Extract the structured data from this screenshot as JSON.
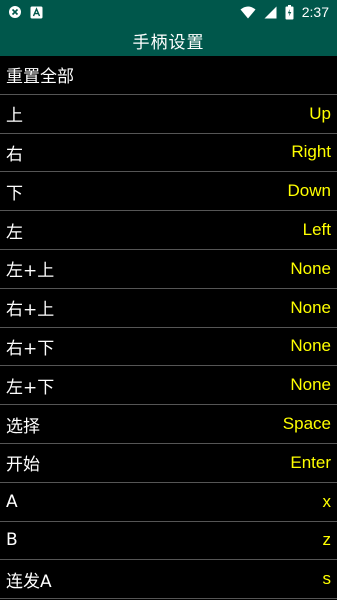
{
  "status_bar": {
    "time": "2:37",
    "left_icons": [
      "notification-close-icon",
      "text-a-icon"
    ],
    "right_icons": [
      "wifi-icon",
      "signal-icon",
      "battery-icon"
    ]
  },
  "app": {
    "title": "手柄设置",
    "accent_color": "#00574B",
    "value_color": "#FFFF00"
  },
  "rows": [
    {
      "label": "重置全部",
      "value": ""
    },
    {
      "label": "上",
      "value": "Up"
    },
    {
      "label": "右",
      "value": "Right"
    },
    {
      "label": "下",
      "value": "Down"
    },
    {
      "label": "左",
      "value": "Left"
    },
    {
      "label": "左+上",
      "value": "None"
    },
    {
      "label": "右+上",
      "value": "None"
    },
    {
      "label": "右+下",
      "value": "None"
    },
    {
      "label": "左+下",
      "value": "None"
    },
    {
      "label": "选择",
      "value": "Space"
    },
    {
      "label": "开始",
      "value": "Enter"
    },
    {
      "label": "A",
      "value": "x"
    },
    {
      "label": "B",
      "value": "z"
    },
    {
      "label": "连发A",
      "value": "s"
    }
  ]
}
